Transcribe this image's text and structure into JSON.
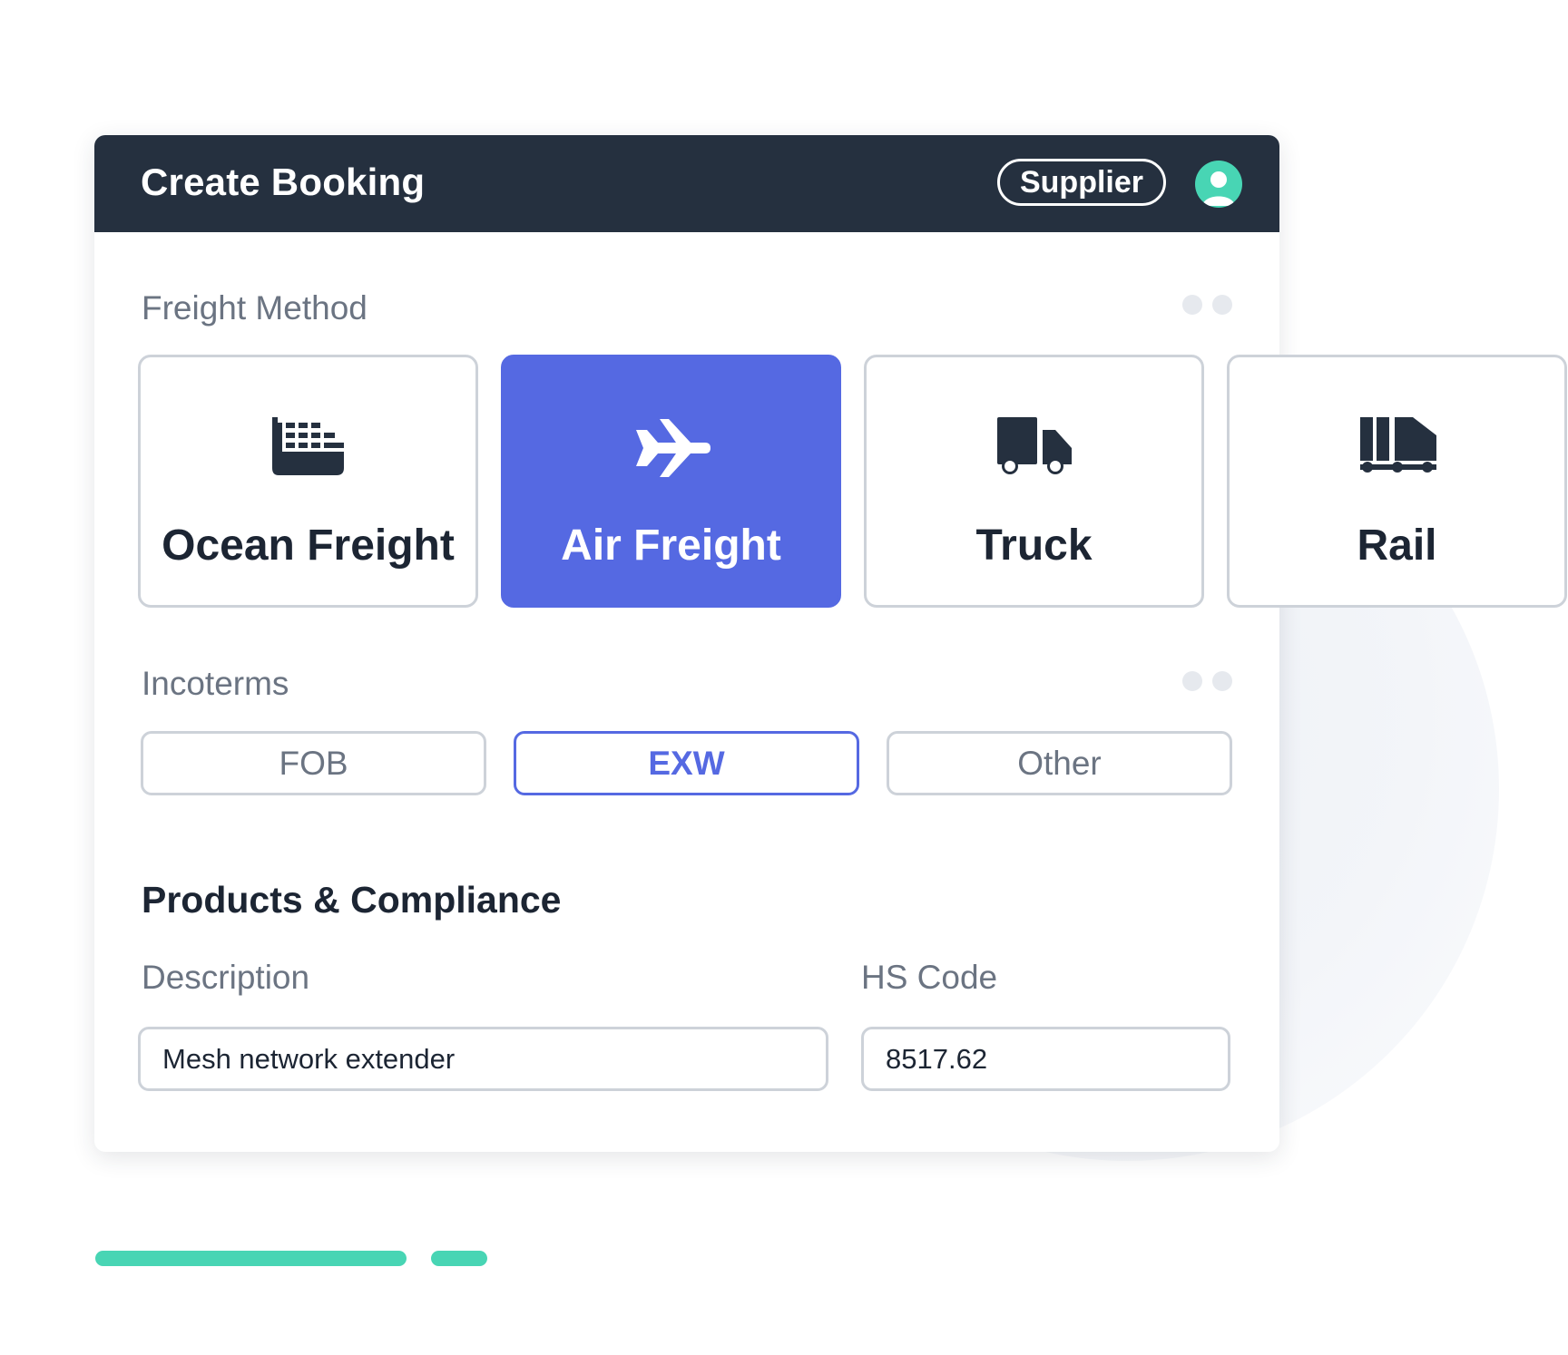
{
  "header": {
    "title": "Create Booking",
    "role": "Supplier",
    "avatar_icon": "user-avatar-icon"
  },
  "freight_method": {
    "label": "Freight Method",
    "options": [
      {
        "label": "Ocean Freight",
        "icon": "ship-icon",
        "selected": false
      },
      {
        "label": "Air Freight",
        "icon": "plane-icon",
        "selected": true
      },
      {
        "label": "Truck",
        "icon": "truck-icon",
        "selected": false
      },
      {
        "label": "Rail",
        "icon": "train-icon",
        "selected": false
      }
    ]
  },
  "incoterms": {
    "label": "Incoterms",
    "options": [
      {
        "label": "FOB",
        "selected": false
      },
      {
        "label": "EXW",
        "selected": true
      },
      {
        "label": "Other",
        "selected": false
      }
    ]
  },
  "products": {
    "heading": "Products & Compliance",
    "description": {
      "label": "Description",
      "value": "Mesh network extender"
    },
    "hs_code": {
      "label": "HS Code",
      "value": "8517.62"
    }
  },
  "colors": {
    "header_bg": "#25303f",
    "accent": "#5569e2",
    "teal": "#48d5b4",
    "border": "#cdd2d9",
    "text_dark": "#1c2533",
    "text_muted": "#6b7482"
  }
}
